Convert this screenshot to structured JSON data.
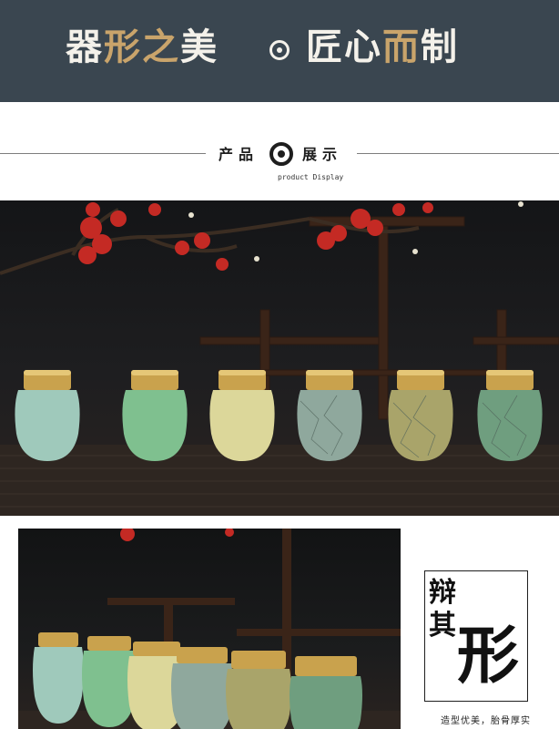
{
  "banner": {
    "title_left_1": "器",
    "title_left_2": "形之",
    "title_left_3": "美",
    "title_right_1": "匠心",
    "title_right_2": "而",
    "title_right_3": "制"
  },
  "section": {
    "title_left": "产品",
    "title_right": "展示",
    "subtitle": "product Display"
  },
  "feature": {
    "char_1": "辩",
    "char_2": "其",
    "char_big": "形",
    "caption": "造型优美，胎骨厚实"
  },
  "colors": {
    "banner_bg": "#3a4650",
    "gold": "#c9a46b",
    "jar_glazes": [
      "#9fc9bb",
      "#7fc08f",
      "#dcd79a",
      "#8fa89d",
      "#a9a46a",
      "#6f9e7f"
    ]
  }
}
